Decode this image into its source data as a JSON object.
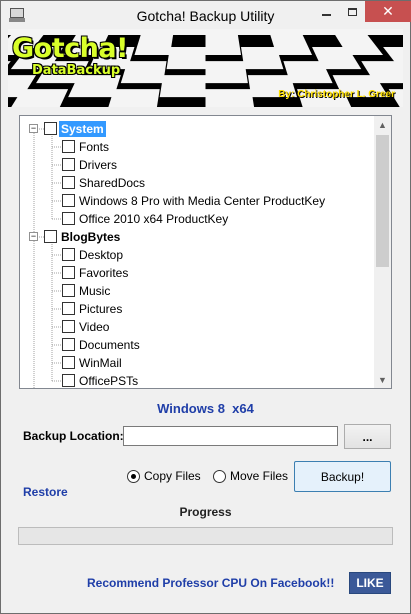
{
  "window": {
    "title": "Gotcha! Backup Utility",
    "close_label": "✕"
  },
  "banner": {
    "logo_main": "Gotcha!",
    "logo_sub": "DataBackup",
    "author": "By: Christopher L. Greer"
  },
  "tree": {
    "nodes": [
      {
        "label": "System",
        "level": 0,
        "expanded": true,
        "bold": true,
        "selected": true,
        "checked": false
      },
      {
        "label": "Fonts",
        "level": 1,
        "checked": false
      },
      {
        "label": "Drivers",
        "level": 1,
        "checked": false
      },
      {
        "label": "SharedDocs",
        "level": 1,
        "checked": false
      },
      {
        "label": "Windows 8 Pro with Media Center ProductKey",
        "level": 1,
        "checked": false
      },
      {
        "label": "Office 2010 x64 ProductKey",
        "level": 1,
        "checked": false
      },
      {
        "label": "BlogBytes",
        "level": 0,
        "expanded": true,
        "bold": true,
        "checked": false
      },
      {
        "label": "Desktop",
        "level": 1,
        "checked": false
      },
      {
        "label": "Favorites",
        "level": 1,
        "checked": false
      },
      {
        "label": "Music",
        "level": 1,
        "checked": false
      },
      {
        "label": "Pictures",
        "level": 1,
        "checked": false
      },
      {
        "label": "Video",
        "level": 1,
        "checked": false
      },
      {
        "label": "Documents",
        "level": 1,
        "checked": false
      },
      {
        "label": "WinMail",
        "level": 1,
        "checked": false
      },
      {
        "label": "OfficePSTs",
        "level": 1,
        "checked": false
      }
    ],
    "expander_glyph": "−"
  },
  "os_label": "Windows 8  x64",
  "backup_location": {
    "label": "Backup Location:",
    "value": "",
    "browse_label": "..."
  },
  "options": {
    "copy_label": "Copy Files",
    "move_label": "Move Files",
    "selected": "copy"
  },
  "backup_button_label": "Backup!",
  "restore_label": "Restore",
  "progress": {
    "label": "Progress",
    "value": 0
  },
  "footer": {
    "promo": "Recommend Professor CPU On Facebook!!",
    "like_label": "LIKE"
  },
  "colors": {
    "accent_text": "#1f3ea8",
    "selection": "#3399ff",
    "close_button": "#c75050",
    "facebook": "#3b5998"
  }
}
